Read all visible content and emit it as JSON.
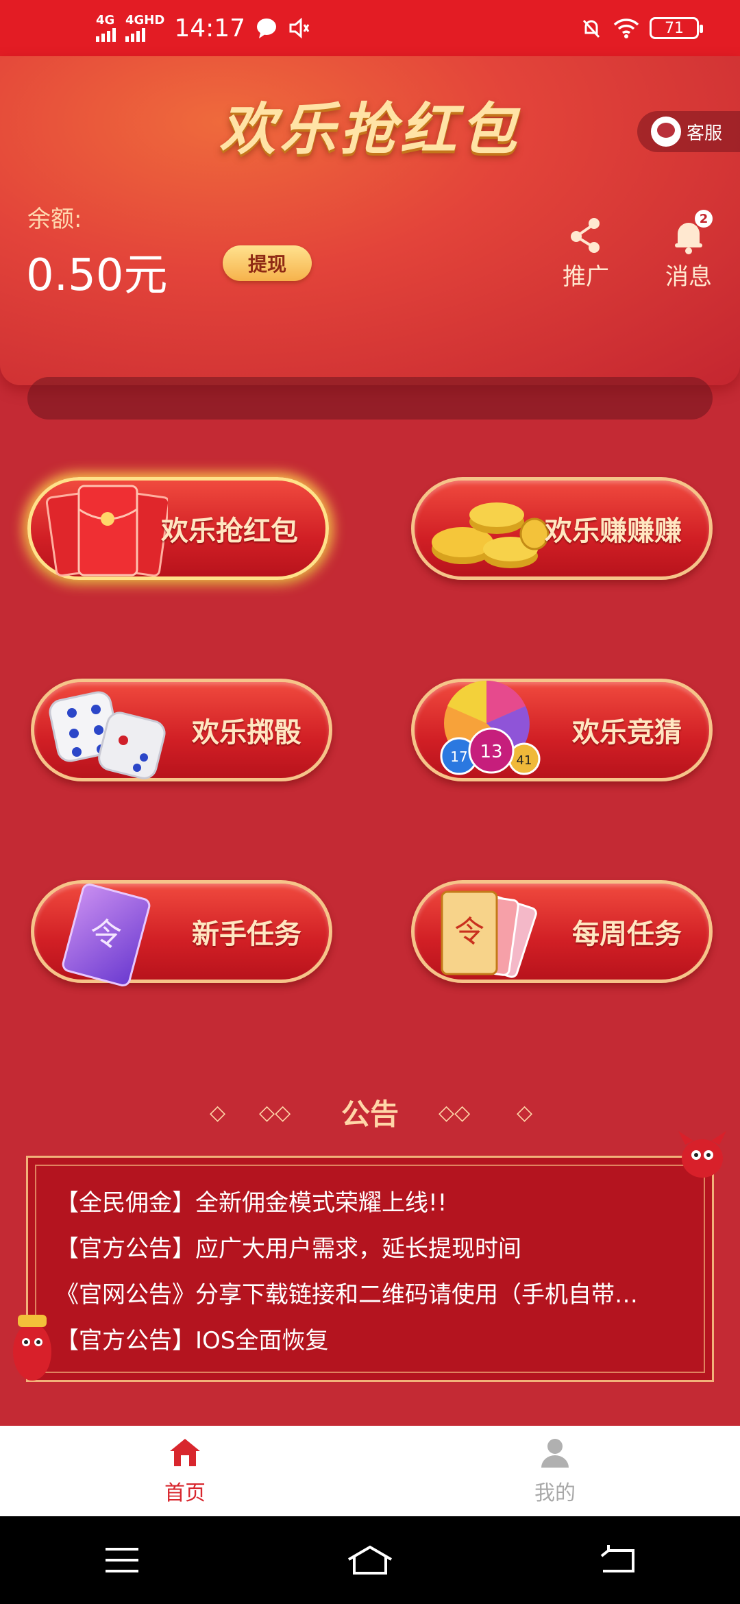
{
  "status_bar": {
    "time": "14:17",
    "signal_1": "4G",
    "signal_2": "4GHD",
    "battery": "71"
  },
  "header": {
    "title": "欢乐抢红包",
    "service_label": "客服",
    "balance_label": "余额:",
    "balance_value": "0.50元",
    "withdraw_label": "提现",
    "promote_label": "推广",
    "messages_label": "消息",
    "messages_badge": "2"
  },
  "games": [
    {
      "label": "欢乐抢红包",
      "icon": "red-envelope-icon"
    },
    {
      "label": "欢乐赚赚赚",
      "icon": "gold-coins-icon"
    },
    {
      "label": "欢乐掷骰",
      "icon": "dice-icon"
    },
    {
      "label": "欢乐竞猜",
      "icon": "lottery-ball-icon"
    },
    {
      "label": "新手任务",
      "icon": "purple-card-icon"
    },
    {
      "label": "每周任务",
      "icon": "cards-icon"
    }
  ],
  "announcements": {
    "title": "公告",
    "items": [
      "【全民佣金】全新佣金模式荣耀上线!!",
      "【官方公告】应广大用户需求，延长提现时间",
      "《官网公告》分享下载链接和二维码请使用（手机自带…",
      "【官方公告】IOS全面恢复"
    ]
  },
  "bottom_nav": {
    "home_label": "首页",
    "me_label": "我的"
  },
  "colors": {
    "brand_red": "#e31c24",
    "gold": "#ffe3a6",
    "active_tab": "#d8262d"
  }
}
